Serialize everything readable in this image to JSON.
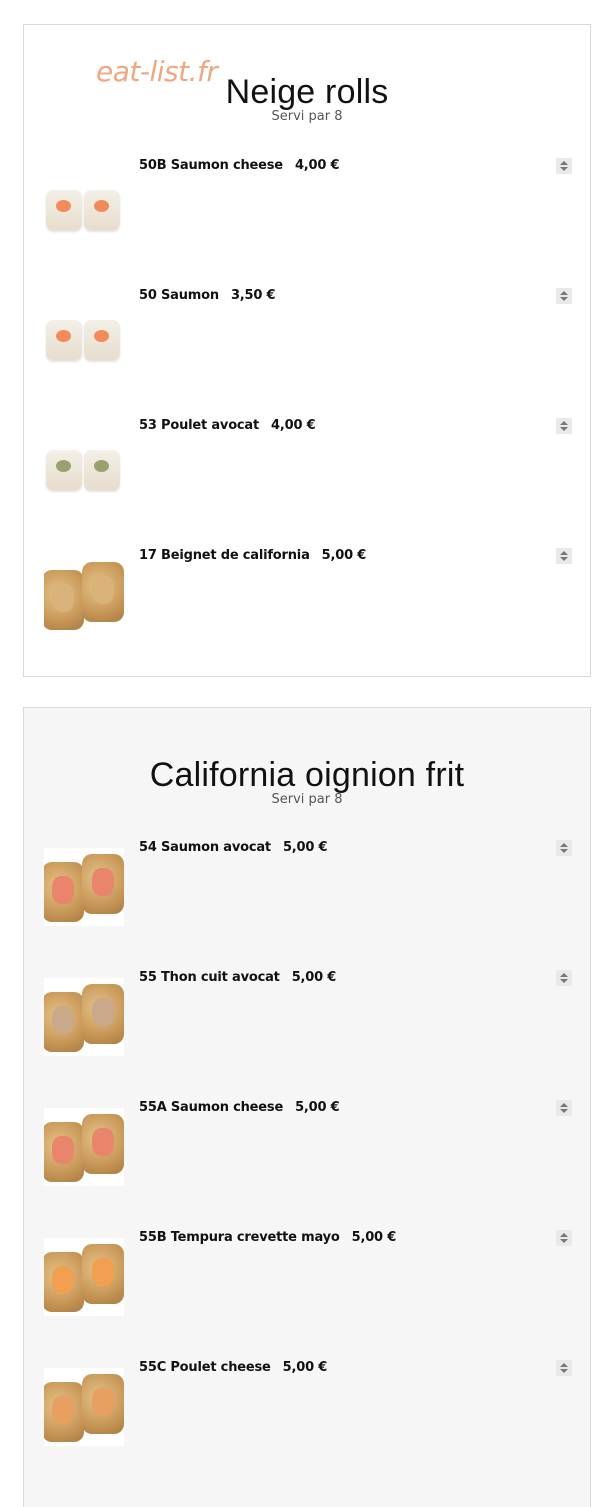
{
  "watermark": "eat-list.fr",
  "sections": [
    {
      "title": "Neige rolls",
      "subtitle": "Servi par 8",
      "items": [
        {
          "label": "50B Saumon cheese",
          "price": "4,00 €",
          "thumb": "roll-salmon-cheese",
          "fill": "#f28a5c"
        },
        {
          "label": "50 Saumon",
          "price": "3,50 €",
          "thumb": "roll-salmon",
          "fill": "#f28a5c"
        },
        {
          "label": "53 Poulet avocat",
          "price": "4,00 €",
          "thumb": "roll-chicken-avocado",
          "fill": "#9aa070"
        },
        {
          "label": "17 Beignet de california",
          "price": "5,00 €",
          "thumb": "roll-fried-california",
          "fill": "#d9b47a"
        }
      ]
    },
    {
      "title": "California oignion frit",
      "subtitle": "Servi par 8",
      "items": [
        {
          "label": "54 Saumon avocat",
          "price": "5,00 €",
          "thumb": "roll-salmon-avocado",
          "fill": "#e9856a"
        },
        {
          "label": "55 Thon cuit avocat",
          "price": "5,00 €",
          "thumb": "roll-tuna-avocado",
          "fill": "#c9a98a"
        },
        {
          "label": "55A Saumon cheese",
          "price": "5,00 €",
          "thumb": "roll-salmon-cheese-crisp",
          "fill": "#e9856a"
        },
        {
          "label": "55B Tempura crevette mayo",
          "price": "5,00 €",
          "thumb": "roll-shrimp-tempura",
          "fill": "#f0a050"
        },
        {
          "label": "55C Poulet cheese",
          "price": "5,00 €",
          "thumb": "roll-chicken-cheese",
          "fill": "#e8a060"
        }
      ]
    }
  ]
}
